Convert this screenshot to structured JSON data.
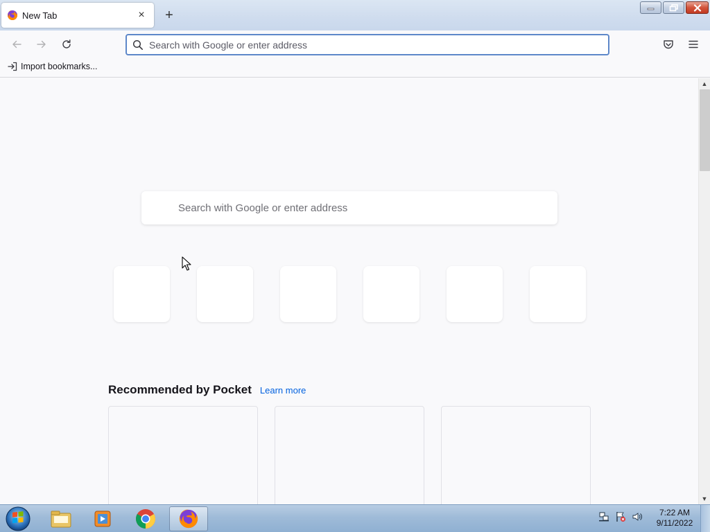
{
  "browser": {
    "tab": {
      "title": "New Tab",
      "close_glyph": "×",
      "icon": "firefox-icon"
    },
    "new_tab_glyph": "+",
    "window_controls": [
      "minimize",
      "restore",
      "close"
    ]
  },
  "navbar": {
    "url_placeholder": "Search with Google or enter address",
    "url_value": "",
    "icons": [
      "back-arrow-icon",
      "forward-arrow-icon",
      "reload-icon",
      "search-icon",
      "pocket-icon",
      "hamburger-menu-icon"
    ]
  },
  "bookmarks_toolbar": {
    "import_label": "Import bookmarks..."
  },
  "newtab": {
    "search_placeholder": "Search with Google or enter address",
    "top_sites_count_visible": 6,
    "pocket": {
      "title": "Recommended by Pocket",
      "learn_more": "Learn more"
    }
  },
  "taskbar": {
    "clock_time": "7:22 AM",
    "clock_date": "9/11/2022",
    "pinned": [
      "windows-explorer-icon",
      "media-player-icon",
      "chrome-icon",
      "firefox-icon"
    ],
    "active_app": "firefox"
  },
  "colors": {
    "accent_link": "#0060df",
    "url_focus_border": "#5d87c9",
    "page_bg": "#f9f9fb"
  }
}
